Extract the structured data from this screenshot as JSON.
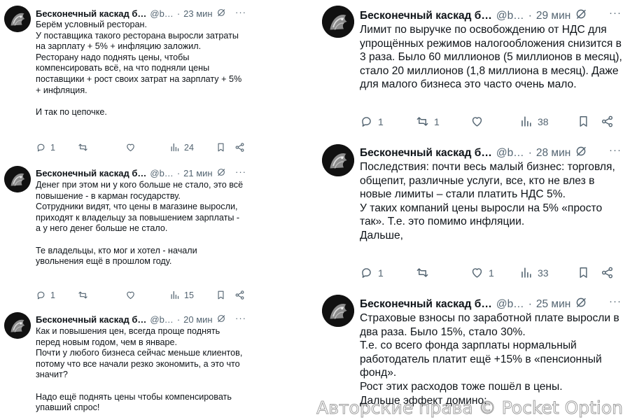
{
  "author": {
    "name": "Бесконечный каскад б…",
    "handle": "@b…",
    "dot": "·",
    "more": "···"
  },
  "left_column": {
    "tweets": [
      {
        "time": "23 мин",
        "text": "Берём условный ресторан.\nУ поставщика такого ресторана выросли затраты на зарплату + 5% + инфляцию заложил.\nРесторану надо поднять цены, чтобы компенсировать всё, на что подняли цены поставщики + рост своих затрат на зарплату + 5% + инфляция.\n\nИ так по цепочке.",
        "replies": "1",
        "retweets": "",
        "likes": "",
        "views": "24"
      },
      {
        "time": "21 мин",
        "text": "Денег при этом ни у кого больше не стало, это всё повышение - в карман государству.\nСотрудники видят, что цены в магазине выросли, приходят к владельцу за повышением зарплаты - а у него денег больше не стало.\n\nТе владельцы, кто мог и хотел - начали увольнения ещё в прошлом году.",
        "replies": "1",
        "retweets": "",
        "likes": "",
        "views": "15"
      },
      {
        "time": "20 мин",
        "text": "Как и повышения цен, всегда проще поднять перед новым годом, чем в январе.\nПочти у любого бизнеса сейчас меньше клиентов, потому что все начали резко экономить, а это что значит?\n\nНадо ещё поднять цены чтобы компенсировать упавший спрос!",
        "replies": "",
        "retweets": "",
        "likes": "",
        "views": ""
      }
    ]
  },
  "right_column": {
    "tweets": [
      {
        "time": "29 мин",
        "text": "Лимит по выручке по освобождению от НДС для упрощённых режимов налогообложения снизится в 3 раза. Было 60 миллионов (5 миллионов в месяц), стало 20 миллионов (1,8 миллиона в месяц). Даже для малого бизнеса это часто очень мало.",
        "replies": "1",
        "retweets": "1",
        "likes": "",
        "views": "38"
      },
      {
        "time": "28 мин",
        "text": "Последствия: почти весь малый бизнес: торговля, общепит, различные услуги, все, кто не влез в новые лимиты – стали платить НДС 5%.\nУ таких компаний цены выросли на 5% «просто так». Т.е. это помимо инфляции.\nДальше,",
        "replies": "1",
        "retweets": "",
        "likes": "1",
        "views": "33"
      },
      {
        "time": "25 мин",
        "text": "Страховые взносы по заработной плате выросли в два раза. Было 15%, стало 30%.\nТ.е. со всего фонда  зарплаты нормальный работодатель платит ещё +15% в «пенсионный фонд».\nРост этих расходов тоже пошёл в цены.\nДальше эффект домино:",
        "replies": "",
        "retweets": "",
        "likes": "",
        "views": ""
      }
    ]
  },
  "watermark": "Авторские права © Pocket Option",
  "colors": {
    "text": "#0f1419",
    "muted": "#536471",
    "background": "#ffffff",
    "divider": "#ffffff"
  },
  "icons": [
    "reply-icon",
    "retweet-icon",
    "like-icon",
    "views-icon",
    "bookmark-icon",
    "share-icon",
    "edited-icon"
  ]
}
